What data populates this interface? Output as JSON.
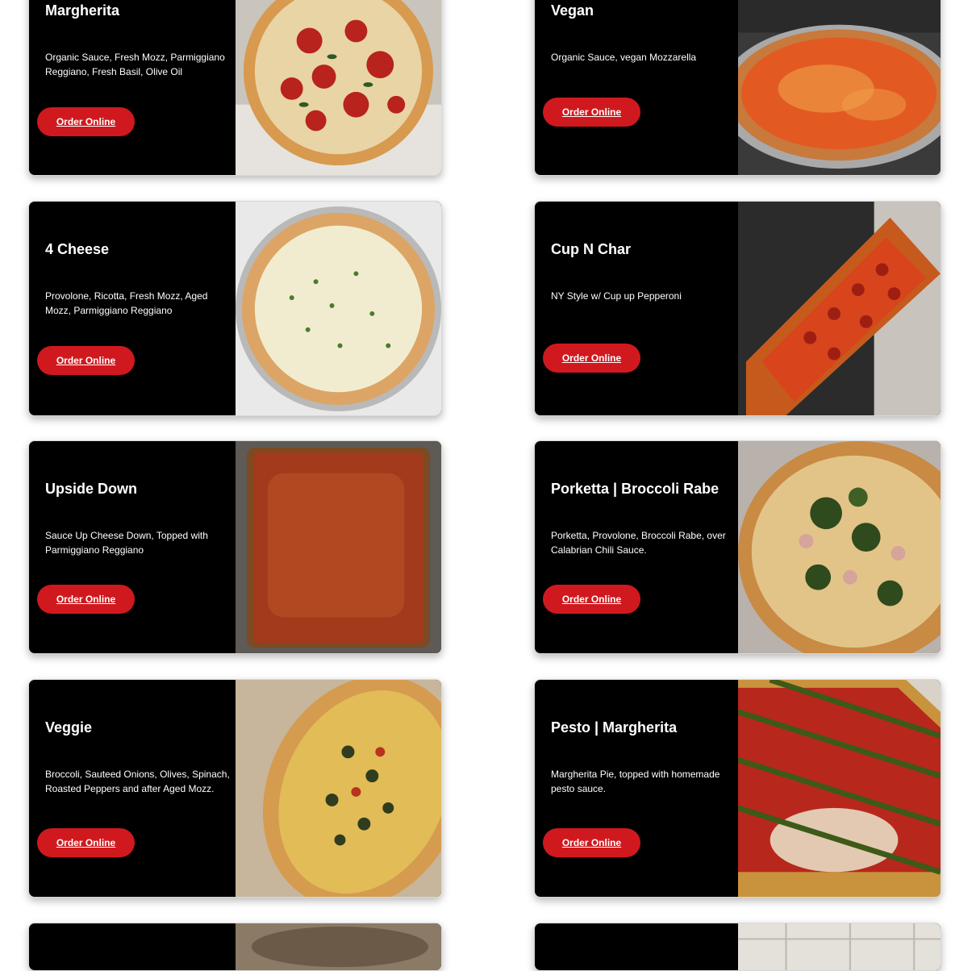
{
  "menu": {
    "items": [
      {
        "title": "Margherita",
        "description": "Organic Sauce, Fresh Mozz, Parmiggiano Reggiano, Fresh Basil, Olive Oil",
        "order_label": "Order Online"
      },
      {
        "title": "Vegan",
        "description": "Organic Sauce, vegan Mozzarella",
        "order_label": "Order Online"
      },
      {
        "title": "4 Cheese",
        "description": "Provolone, Ricotta, Fresh Mozz, Aged Mozz, Parmiggiano Reggiano",
        "order_label": "Order Online"
      },
      {
        "title": "Cup N Char",
        "description": "NY Style w/ Cup up Pepperoni",
        "order_label": "Order Online"
      },
      {
        "title": "Upside Down",
        "description": "Sauce Up Cheese Down, Topped with Parmiggiano Reggiano",
        "order_label": "Order Online"
      },
      {
        "title": "Porketta | Broccoli Rabe",
        "description": "Porketta, Provolone, Broccoli Rabe, over Calabrian Chili Sauce.",
        "order_label": "Order Online"
      },
      {
        "title": "Veggie",
        "description": "Broccoli, Sauteed Onions, Olives, Spinach, Roasted Peppers and after Aged Mozz.",
        "order_label": "Order Online"
      },
      {
        "title": "Pesto | Margherita",
        "description": "Margherita Pie, topped with homemade pesto sauce.",
        "order_label": "Order Online"
      }
    ]
  },
  "colors": {
    "card_bg": "#000000",
    "page_bg": "#ffffff",
    "button_bg": "#d0191e",
    "text": "#ffffff"
  }
}
